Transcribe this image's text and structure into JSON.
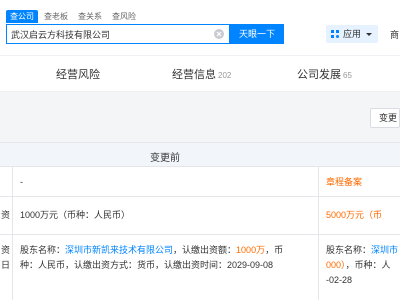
{
  "search": {
    "tabs": [
      "查公司",
      "查老板",
      "查关系",
      "查风险"
    ],
    "query": "武汉启云方科技有限公司",
    "button_label": "天眼一下"
  },
  "header": {
    "app_label": "应用",
    "cut_text": "商"
  },
  "nav": {
    "tabs": [
      {
        "label": "经营风险",
        "count": ""
      },
      {
        "label": "经营信息",
        "count": "202"
      },
      {
        "label": "公司发展",
        "count": "65"
      }
    ]
  },
  "toolbar": {
    "change_label": "变更"
  },
  "table": {
    "header_before": "变更前",
    "rows": [
      {
        "side": "",
        "before": "-",
        "after": "章程备案"
      },
      {
        "side": "资",
        "before": "1000万元（币种：人民币）",
        "after": "5000万元（币"
      },
      {
        "side_lines": [
          "资",
          "日"
        ],
        "before_prefix": "股东名称：",
        "before_company": "深圳市新凯来技术有限公司",
        "before_mid": "，认缴出资额：",
        "before_amount": "1000万",
        "before_suffix": "，币",
        "before_line2": "种：人民币，认缴出资方式：货币，认缴出资时间：2029-09-08",
        "after_line1_prefix": "股东名称：",
        "after_line1_link": "深圳市",
        "after_line2_amount": "000）",
        "after_line2_suffix": "，币种：人",
        "after_line3": "-02-28"
      }
    ]
  }
}
